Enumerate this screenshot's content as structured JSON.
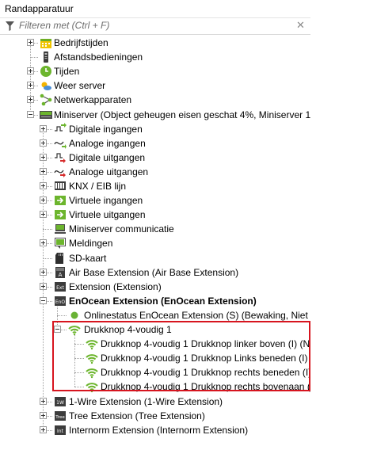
{
  "panel": {
    "title": "Randapparatuur",
    "filter": {
      "placeholder": "Filteren met (Ctrl + F)",
      "value": "",
      "icon": "funnel-icon",
      "clear_icon": "clear-icon"
    }
  },
  "colors": {
    "highlight_border": "#d7151f",
    "wifi_green": "#6cb52d",
    "status_green": "#69b234"
  },
  "tree": {
    "nodes": [
      {
        "label": "Bedrijfstijden",
        "icon": "calendar-icon",
        "expander": "plus"
      },
      {
        "label": "Afstandsbedieningen",
        "icon": "remote-icon",
        "expander": "none"
      },
      {
        "label": "Tijden",
        "icon": "clock-icon",
        "expander": "plus"
      },
      {
        "label": "Weer server",
        "icon": "weather-icon",
        "expander": "plus"
      },
      {
        "label": "Netwerkapparaten",
        "icon": "network-icon",
        "expander": "plus"
      },
      {
        "label": "Miniserver (Object geheugen eisen geschat 4%, Miniserver 14",
        "icon": "miniserver-icon",
        "expander": "minus"
      },
      {
        "label": "Digitale ingangen",
        "icon": "digital-input-icon",
        "expander": "plus"
      },
      {
        "label": "Analoge ingangen",
        "icon": "analog-input-icon",
        "expander": "plus"
      },
      {
        "label": "Digitale uitgangen",
        "icon": "digital-output-icon",
        "expander": "plus"
      },
      {
        "label": "Analoge uitgangen",
        "icon": "analog-output-icon",
        "expander": "plus"
      },
      {
        "label": "KNX / EIB lijn",
        "icon": "knx-icon",
        "expander": "plus"
      },
      {
        "label": "Virtuele ingangen",
        "icon": "virtual-input-icon",
        "expander": "plus"
      },
      {
        "label": "Virtuele uitgangen",
        "icon": "virtual-output-icon",
        "expander": "plus"
      },
      {
        "label": "Miniserver communicatie",
        "icon": "communication-icon",
        "expander": "none"
      },
      {
        "label": "Meldingen",
        "icon": "notification-icon",
        "expander": "plus"
      },
      {
        "label": "SD-kaart",
        "icon": "sd-card-icon",
        "expander": "none"
      },
      {
        "label": "Air Base Extension (Air Base Extension)",
        "icon": "air-base-icon",
        "expander": "plus"
      },
      {
        "label": "Extension (Extension)",
        "icon": "extension-icon",
        "expander": "plus"
      },
      {
        "label": "EnOcean Extension (EnOcean Extension)",
        "icon": "enocean-icon",
        "expander": "minus",
        "bold": true
      },
      {
        "label": "Onlinestatus EnOcean Extension (S) (Bewaking, Niet to",
        "icon": "status-dot-icon",
        "expander": "none"
      },
      {
        "label": "Drukknop 4-voudig 1",
        "icon": "wifi-icon",
        "expander": "minus"
      },
      {
        "label": "Drukknop 4-voudig 1 Drukknop linker boven (I) (N",
        "icon": "wifi-icon",
        "expander": "none"
      },
      {
        "label": "Drukknop 4-voudig 1 Drukknop Links beneden (I)",
        "icon": "wifi-icon",
        "expander": "none"
      },
      {
        "label": "Drukknop 4-voudig 1 Drukknop rechts beneden (I)",
        "icon": "wifi-icon",
        "expander": "none"
      },
      {
        "label": "Drukknop 4-voudig 1 Drukknop rechts bovenaan (I",
        "icon": "wifi-icon",
        "expander": "none"
      },
      {
        "label": "1-Wire Extension (1-Wire Extension)",
        "icon": "one-wire-icon",
        "expander": "plus"
      },
      {
        "label": "Tree Extension (Tree Extension)",
        "icon": "tree-extension-icon",
        "expander": "plus"
      },
      {
        "label": "Internorm Extension (Internorm Extension)",
        "icon": "internorm-icon",
        "expander": "plus"
      }
    ]
  }
}
